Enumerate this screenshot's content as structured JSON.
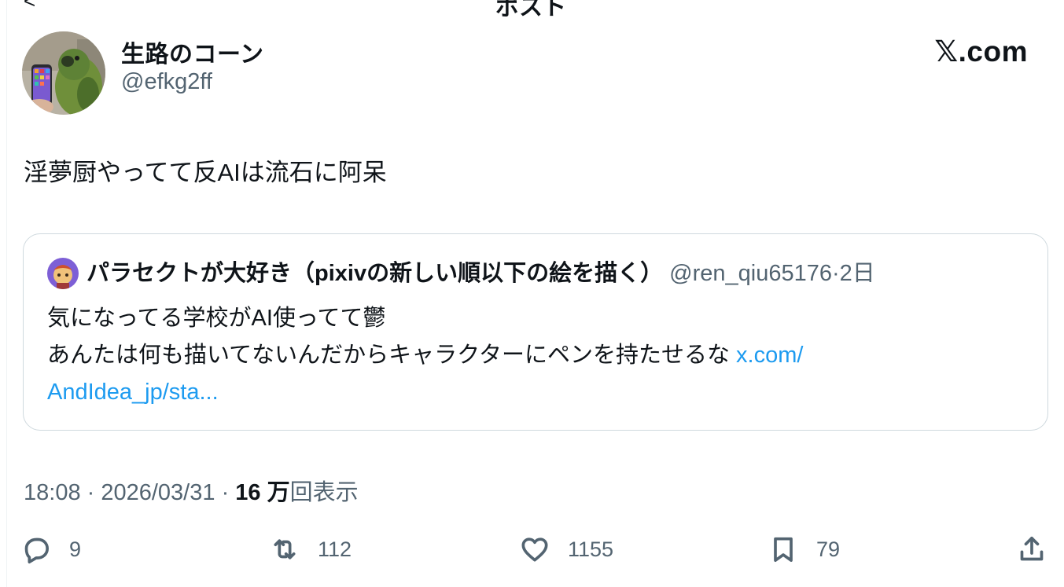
{
  "top_cut_text": "ポスト",
  "top_cut_left": "<",
  "author": {
    "name": "生路のコーン",
    "handle": "@efkg2ff"
  },
  "brand": {
    "label": "𝕏.com"
  },
  "tweet": {
    "text": "淫夢厨やってて反AIは流石に阿呆"
  },
  "quote": {
    "name": "パラセクトが大好き（pixivの新しい順以下の絵を描く）",
    "handle": "@ren_qiu65176",
    "separator": "·",
    "time": "2日",
    "line1": "気になってる学校がAI使ってて鬱",
    "line2": "あんたは何も描いてないんだからキャラクターにペンを持たせるな ",
    "link_part1": "x.com/",
    "link_part2": "AndIdea_jp/sta..."
  },
  "meta": {
    "time": "18:08",
    "sep1": " · ",
    "date": "2026/03/31",
    "sep2": " · ",
    "views_count": "16 万",
    "views_label": "回表示"
  },
  "actions": {
    "reply_count": "9",
    "retweet_count": "112",
    "like_count": "1155",
    "bookmark_count": "79"
  },
  "icons": {
    "reply": "reply-icon",
    "retweet": "retweet-icon",
    "like": "heart-icon",
    "bookmark": "bookmark-icon",
    "share": "share-icon"
  },
  "colors": {
    "link": "#1d9bf0",
    "secondary_text": "#536471",
    "primary_text": "#0f1419",
    "border": "#cfd9de"
  }
}
